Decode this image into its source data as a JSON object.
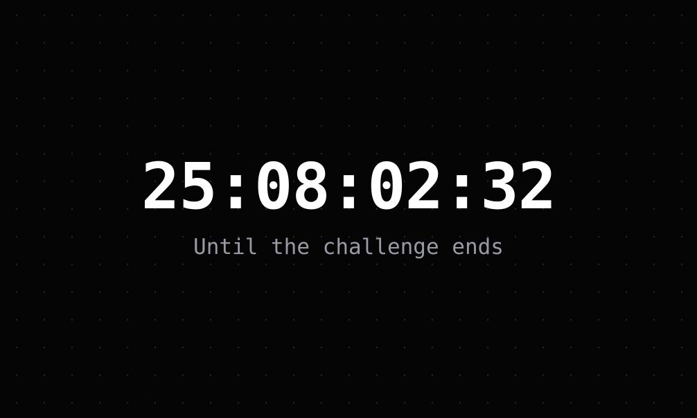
{
  "countdown": {
    "value": "25:08:02:32",
    "caption": "Until the challenge ends"
  },
  "colors": {
    "background": "#050505",
    "dot": "#2a2a2a",
    "countdown_text": "#ffffff",
    "caption_text": "#9a9aa6"
  }
}
